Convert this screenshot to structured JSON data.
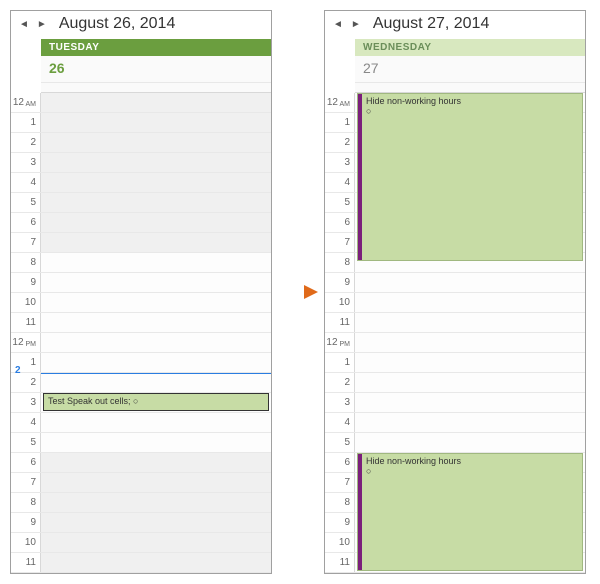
{
  "left": {
    "date_title": "August 26, 2014",
    "day_name": "TUESDAY",
    "day_number": "26",
    "now_hour": 2,
    "now_label": "2",
    "hours": [
      {
        "label": "12",
        "ampm": "AM",
        "nonwork": true
      },
      {
        "label": "1",
        "nonwork": true
      },
      {
        "label": "2",
        "nonwork": true
      },
      {
        "label": "3",
        "nonwork": true
      },
      {
        "label": "4",
        "nonwork": true
      },
      {
        "label": "5",
        "nonwork": true
      },
      {
        "label": "6",
        "nonwork": true
      },
      {
        "label": "7",
        "nonwork": true
      },
      {
        "label": "8",
        "nonwork": false
      },
      {
        "label": "9",
        "nonwork": false
      },
      {
        "label": "10",
        "nonwork": false
      },
      {
        "label": "11",
        "nonwork": false
      },
      {
        "label": "12",
        "ampm": "PM",
        "nonwork": false
      },
      {
        "label": "1",
        "nonwork": false
      },
      {
        "label": "2",
        "nonwork": false
      },
      {
        "label": "3",
        "nonwork": false
      },
      {
        "label": "4",
        "nonwork": false
      },
      {
        "label": "5",
        "nonwork": false
      },
      {
        "label": "6",
        "nonwork": true
      },
      {
        "label": "7",
        "nonwork": true
      },
      {
        "label": "8",
        "nonwork": true
      },
      {
        "label": "9",
        "nonwork": true
      },
      {
        "label": "10",
        "nonwork": true
      },
      {
        "label": "11",
        "nonwork": true
      }
    ],
    "appointments": [
      {
        "title": "Test Speak out cells; ○",
        "start": 15,
        "span": 1,
        "stripe": false,
        "border": true
      }
    ]
  },
  "right": {
    "date_title": "August 27, 2014",
    "day_name": "WEDNESDAY",
    "day_number": "27",
    "now_hour": null,
    "hours": [
      {
        "label": "12",
        "ampm": "AM",
        "nonwork": false
      },
      {
        "label": "1",
        "nonwork": false
      },
      {
        "label": "2",
        "nonwork": false
      },
      {
        "label": "3",
        "nonwork": false
      },
      {
        "label": "4",
        "nonwork": false
      },
      {
        "label": "5",
        "nonwork": false
      },
      {
        "label": "6",
        "nonwork": false
      },
      {
        "label": "7",
        "nonwork": false
      },
      {
        "label": "8",
        "nonwork": false
      },
      {
        "label": "9",
        "nonwork": false
      },
      {
        "label": "10",
        "nonwork": false
      },
      {
        "label": "11",
        "nonwork": false
      },
      {
        "label": "12",
        "ampm": "PM",
        "nonwork": false
      },
      {
        "label": "1",
        "nonwork": false
      },
      {
        "label": "2",
        "nonwork": false
      },
      {
        "label": "3",
        "nonwork": false
      },
      {
        "label": "4",
        "nonwork": false
      },
      {
        "label": "5",
        "nonwork": false
      },
      {
        "label": "6",
        "nonwork": false
      },
      {
        "label": "7",
        "nonwork": false
      },
      {
        "label": "8",
        "nonwork": false
      },
      {
        "label": "9",
        "nonwork": false
      },
      {
        "label": "10",
        "nonwork": false
      },
      {
        "label": "11",
        "nonwork": false
      }
    ],
    "appointments": [
      {
        "title": "Hide non-working hours",
        "sub": "○",
        "start": 0,
        "span": 8.5,
        "stripe": true,
        "border": false
      },
      {
        "title": "Hide non-working hours",
        "sub": "○",
        "start": 18,
        "span": 6,
        "stripe": true,
        "border": false
      }
    ]
  },
  "arrow_color": "#e06a1a"
}
